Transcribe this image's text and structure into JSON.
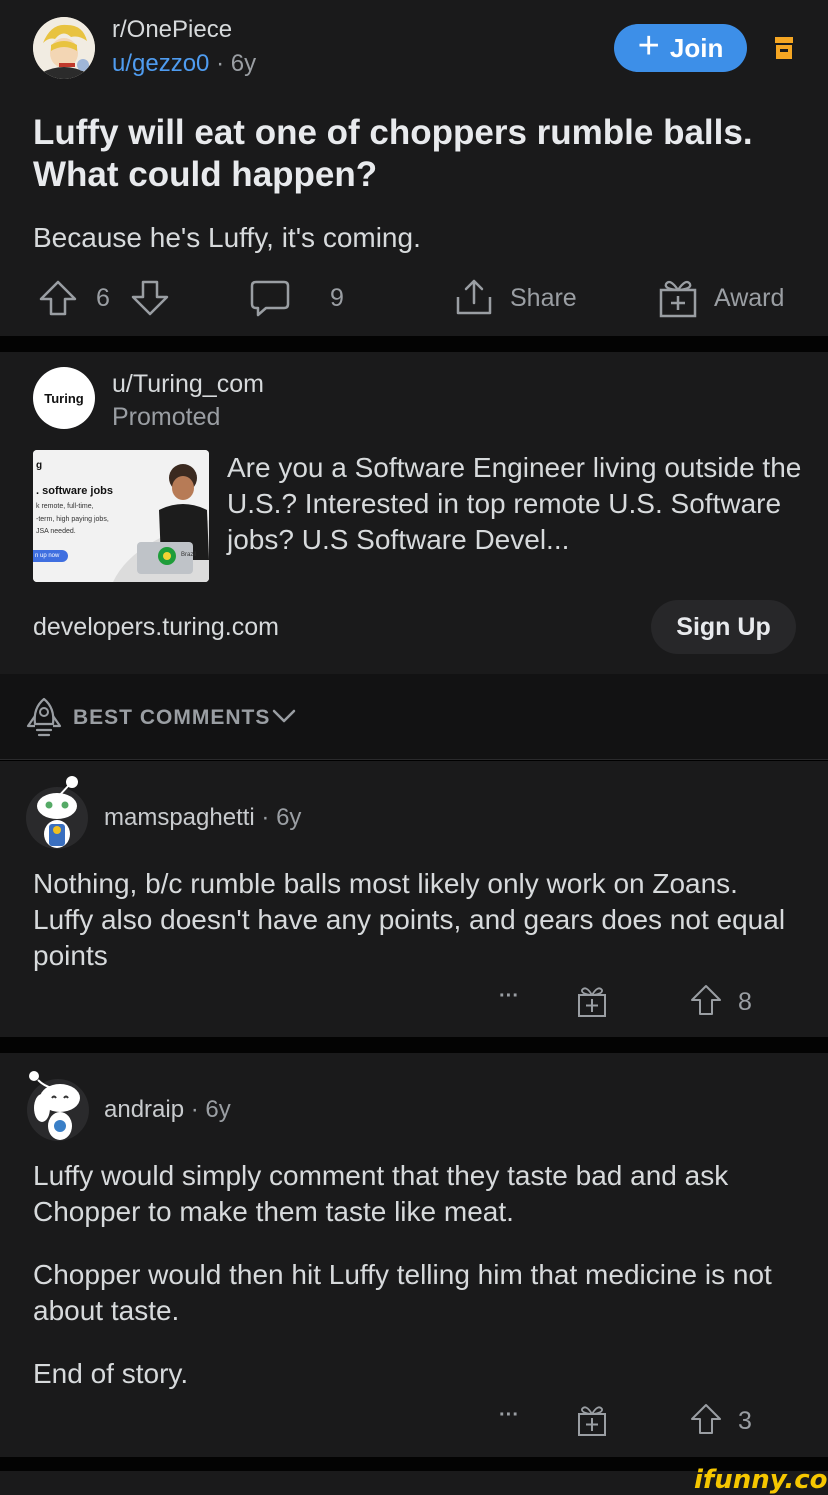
{
  "post": {
    "subreddit": "r/OnePiece",
    "author": "u/gezzo0",
    "age": "· 6y",
    "join_label": "Join",
    "title": "Luffy will eat one of choppers rumble balls. What could happen?",
    "body": "Because he's Luffy, it's coming.",
    "upvotes": "6",
    "comments": "9",
    "share_label": "Share",
    "award_label": "Award"
  },
  "ad": {
    "user": "u/Turing_com",
    "promoted_label": "Promoted",
    "logo_text": "Turing",
    "thumb": {
      "line1": ". software jobs",
      "line2": "k remote, full-time,",
      "line3": "-term, high paying jobs,",
      "line4": "JSA needed.",
      "button": "n up now",
      "flag_label": "Brazil",
      "corner": "g"
    },
    "text": "Are you a Software Engineer living outside the U.S.? Interested in top remote U.S. Software jobs? U.S Software Devel...",
    "domain": "developers.turing.com",
    "cta_label": "Sign Up"
  },
  "sort": {
    "label": "BEST COMMENTS"
  },
  "comments": [
    {
      "username": "mamspaghetti",
      "age": "· 6y",
      "paragraphs": [
        "Nothing, b/c rumble balls most likely only work on Zoans. Luffy also doesn't have any points, and gears does not equal points"
      ],
      "more": "···",
      "votes": "8"
    },
    {
      "username": "andraip",
      "age": "· 6y",
      "paragraphs": [
        "Luffy would simply comment that they taste bad and ask Chopper to make them taste like meat.",
        "Chopper would then hit Luffy telling him that medicine is not about taste.",
        "End of story."
      ],
      "more": "···",
      "votes": "3"
    }
  ],
  "watermark": "ifunny.co",
  "colors": {
    "background": "#1a1a1b",
    "accent": "#3d8fe8",
    "link": "#4f9cf0",
    "text": "#d7dadc",
    "muted": "#9a9ea3",
    "archive": "#f5a623",
    "watermark": "#f6c700"
  }
}
